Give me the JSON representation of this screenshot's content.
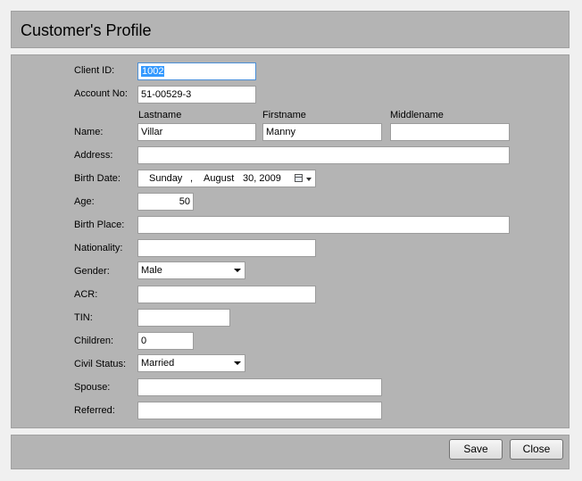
{
  "header": {
    "title": "Customer's Profile"
  },
  "form": {
    "client_id": {
      "label": "Client ID:",
      "value": "1002"
    },
    "account_no": {
      "label": "Account No:",
      "value": "51-00529-3"
    },
    "name": {
      "label": "Name:",
      "lastname_header": "Lastname",
      "firstname_header": "Firstname",
      "middlename_header": "Middlename",
      "lastname": "Villar",
      "firstname": "Manny",
      "middlename": ""
    },
    "address": {
      "label": "Address:",
      "value": ""
    },
    "birth_date": {
      "label": "Birth Date:",
      "weekday": "Sunday",
      "sep": ",",
      "month": "August",
      "day_year": "30, 2009"
    },
    "age": {
      "label": "Age:",
      "value": "50"
    },
    "birth_place": {
      "label": "Birth Place:",
      "value": ""
    },
    "nationality": {
      "label": "Nationality:",
      "value": ""
    },
    "gender": {
      "label": "Gender:",
      "value": "Male"
    },
    "acr": {
      "label": "ACR:",
      "value": ""
    },
    "tin": {
      "label": "TIN:",
      "value": ""
    },
    "children": {
      "label": "Children:",
      "value": "0"
    },
    "civil_status": {
      "label": "Civil Status:",
      "value": "Married"
    },
    "spouse": {
      "label": "Spouse:",
      "value": ""
    },
    "referred": {
      "label": "Referred:",
      "value": ""
    }
  },
  "footer": {
    "save_label": "Save",
    "close_label": "Close"
  },
  "icons": {
    "date_picker": "calendar-icon",
    "dropdown": "chevron-down-icon"
  }
}
